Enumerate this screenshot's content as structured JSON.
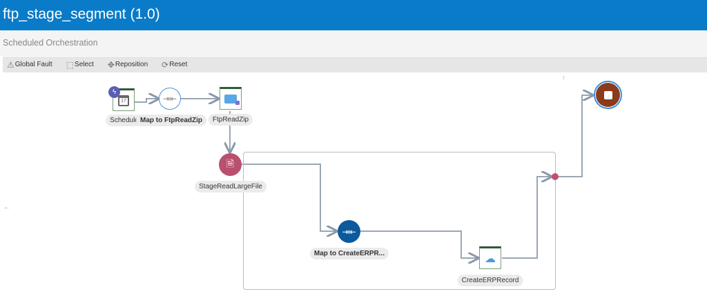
{
  "header": {
    "title": "ftp_stage_segment (1.0)",
    "subtitle": "Scheduled Orchestration"
  },
  "toolbar": {
    "global_fault": "Global Fault",
    "select": "Select",
    "reposition": "Reposition",
    "reset": "Reset"
  },
  "nodes": {
    "schedule": {
      "label": "Schedule",
      "day": "17",
      "icon": "calendar-icon"
    },
    "map_ftp": {
      "label": "Map to FtpReadZip",
      "icon": "map-icon"
    },
    "ftp": {
      "label": "FtpReadZip",
      "icon": "folder-icon"
    },
    "stage": {
      "label": "StageReadLargeFile",
      "icon": "stage-file-icon"
    },
    "map_erp": {
      "label": "Map to CreateERPR...",
      "icon": "map-icon"
    },
    "erp": {
      "label": "CreateERPRecord",
      "icon": "cloud-icon"
    },
    "end": {
      "icon": "stop-icon"
    }
  },
  "colors": {
    "header": "#0a7bc8",
    "stage": "#b8506e",
    "map_active": "#0c5a9c",
    "end": "#8a3b1e",
    "merge": "#c0506e"
  }
}
